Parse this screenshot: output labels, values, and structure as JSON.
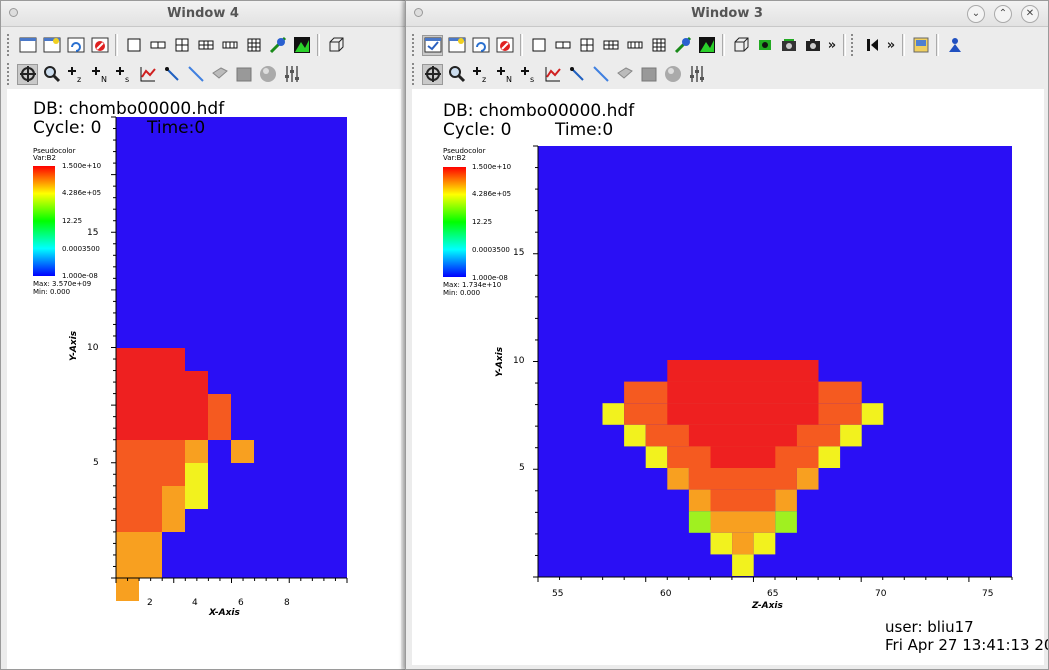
{
  "windows": [
    {
      "title": "Window 4",
      "db_label": "DB: chombo00000.hdf",
      "cycle_label": "Cycle: 0",
      "time_label": "Time:0",
      "legend": {
        "title": "Pseudocolor",
        "var": "Var:B2",
        "ticks": [
          "1.500e+10",
          "4.286e+05",
          "12.25",
          "0.0003500",
          "1.000e-08"
        ],
        "max": "Max: 3.570e+09",
        "min": "Min: 0.000"
      },
      "x_axis_title": "X-Axis",
      "y_axis_title": "Y-Axis",
      "x_ticks": [
        "2",
        "4",
        "6",
        "8"
      ],
      "y_ticks": [
        "15",
        "10",
        "5"
      ],
      "user": "",
      "date": ""
    },
    {
      "title": "Window 3",
      "db_label": "DB: chombo00000.hdf",
      "cycle_label": "Cycle: 0",
      "time_label": "Time:0",
      "legend": {
        "title": "Pseudocolor",
        "var": "Var:B2",
        "ticks": [
          "1.500e+10",
          "4.286e+05",
          "12.25",
          "0.0003500",
          "1.000e-08"
        ],
        "max": "Max: 1.734e+10",
        "min": "Min: 0.000"
      },
      "x_axis_title": "Z-Axis",
      "y_axis_title": "Y-Axis",
      "x_ticks": [
        "55",
        "60",
        "65",
        "70",
        "75"
      ],
      "y_ticks": [
        "15",
        "10",
        "5"
      ],
      "user": "user: bliu17",
      "date": "Fri Apr 27 13:41:13 20"
    }
  ],
  "colors": {
    "background": "#2a0ff5",
    "hot": "#ee2020",
    "warm": "#f55a20",
    "orange": "#f8a020",
    "yellow": "#f2f21e",
    "green": "#a0f020"
  },
  "icons": [
    "new-window-icon",
    "clear-icon",
    "refresh-icon",
    "stop-icon",
    "layout-1-icon",
    "layout-2-icon",
    "layout-4-icon",
    "layout-grid-icon",
    "layout-strip-icon",
    "layout-9-icon",
    "lock-icon",
    "invert-icon",
    "view-3d-icon",
    "navigate-icon",
    "zoom-icon",
    "zone-pick-icon",
    "node-pick-icon",
    "spreadsheet-icon",
    "lineout-icon",
    "line-icon",
    "plane-icon",
    "box-icon",
    "sphere-icon",
    "sliders-icon"
  ]
}
